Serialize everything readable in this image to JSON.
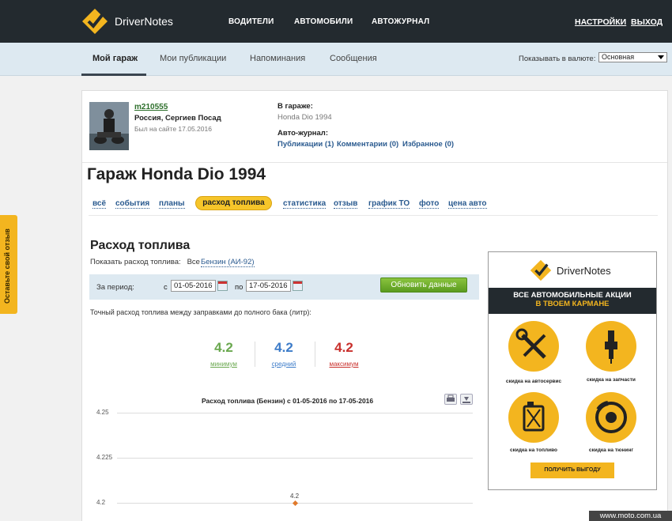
{
  "header": {
    "brand": "DriverNotes",
    "nav": [
      "ВОДИТЕЛИ",
      "АВТОМОБИЛИ",
      "АВТОЖУРНАЛ"
    ],
    "settings": "НАСТРОЙКИ",
    "logout": "ВЫХОД"
  },
  "subnav": {
    "tabs": [
      "Мой гараж",
      "Мои публикации",
      "Напоминания",
      "Сообщения"
    ],
    "currency_label": "Показывать в валюте:",
    "currency_value": "Основная"
  },
  "feedback": "Оставьте свой отзыв",
  "profile": {
    "username": "m210555",
    "location": "Россия, Сергиев Посад",
    "last_seen": "Был на сайте 17.05.2016",
    "garage_label": "В гараже:",
    "garage_value": "Honda Dio 1994",
    "journal_label": "Авто-журнал:",
    "journal_links": [
      "Публикации (1)",
      "Комментарии (0)",
      "Избранное (0)"
    ]
  },
  "page_title": "Гараж Honda Dio 1994",
  "tabs": [
    "всё",
    "события",
    "планы",
    "расход топлива",
    "статистика",
    "отзыв",
    "график ТО",
    "фото",
    "цена авто"
  ],
  "fuel": {
    "title": "Расход топлива",
    "show_label": "Показать расход топлива:",
    "show_all": "Все",
    "fuel_type": "Бензин (АИ-92)",
    "period_label": "За период:",
    "from_label": "с",
    "from_date": "01-05-2016",
    "to_label": "по",
    "to_date": "17-05-2016",
    "refresh_button": "Обновить данные",
    "exact_label": "Точный расход топлива между заправками до полного бака (литр):",
    "stats": [
      {
        "value": "4.2",
        "label": "минимум",
        "color": "#6aa84f"
      },
      {
        "value": "4.2",
        "label": "средний",
        "color": "#3d7cc9"
      },
      {
        "value": "4.2",
        "label": "максимум",
        "color": "#c9302c"
      }
    ]
  },
  "chart_data": {
    "type": "line",
    "title": "Расход топлива (Бензин) с 01-05-2016 по 17-05-2016",
    "xlabel": "",
    "ylabel": "",
    "yticks": [
      "4.25",
      "4.225",
      "4.2"
    ],
    "ylim": [
      4.2,
      4.25
    ],
    "series": [
      {
        "values": [
          4.2
        ]
      }
    ],
    "data_labels": [
      "4.2"
    ],
    "grid": true,
    "point_color": "#e07a2c"
  },
  "ad": {
    "brand": "DriverNotes",
    "line1": "ВСЕ АВТОМОБИЛЬНЫЕ АКЦИИ",
    "line2": "В ТВОЕМ КАРМАНЕ",
    "items": [
      "скидка на автосервис",
      "скидка на запчасти",
      "скидка на топливо",
      "скидка на тюнинг"
    ],
    "button": "ПОЛУЧИТЬ ВЫГОДУ"
  },
  "watermark": "www.moto.com.ua"
}
